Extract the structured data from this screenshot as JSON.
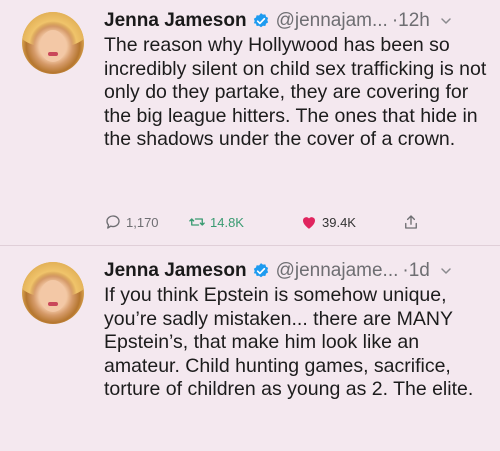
{
  "tweets": [
    {
      "name": "Jenna Jameson",
      "handle": "@jennajam...",
      "separator": "·",
      "time": "12h",
      "text": "The reason why Hollywood has been so incredibly silent on child sex trafficking is not only do they partake, they are covering for the big league hitters. The ones that hide in the shadows under the cover of a crown.",
      "stats": {
        "replies": "1,170",
        "retweets": "14.8K",
        "likes": "39.4K"
      }
    },
    {
      "name": "Jenna Jameson",
      "handle": "@jennajame...",
      "separator": "·",
      "time": "1d",
      "text": "If you think Epstein is somehow unique, you’re sadly mistaken... there are MANY Epstein’s, that make him look like an amateur. Child hunting games, sacrifice, torture of children as young as 2. The elite."
    }
  ],
  "colors": {
    "background": "#f4e8ef",
    "verified": "#1d9bf0",
    "retweet": "#3a9b72",
    "like": "#e0245e",
    "muted": "#6e6e72"
  },
  "icons": [
    "verified-badge-icon",
    "chevron-down-icon",
    "reply-icon",
    "retweet-icon",
    "heart-icon",
    "share-icon"
  ]
}
